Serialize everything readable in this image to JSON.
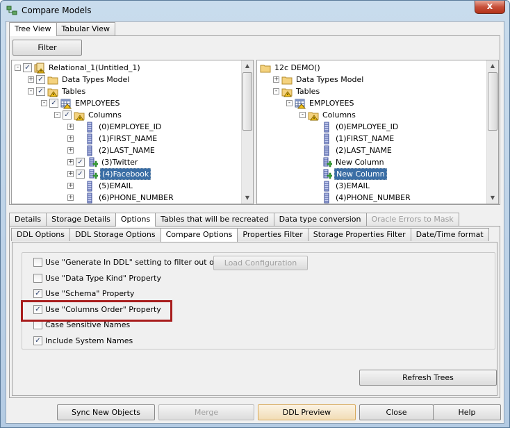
{
  "window": {
    "title": "Compare Models",
    "close_glyph": "x"
  },
  "top_tabs": [
    {
      "label": "Tree View",
      "active": true
    },
    {
      "label": "Tabular View",
      "active": false
    }
  ],
  "filter_button": "Filter",
  "left_tree": [
    {
      "label": "Relational_1(Untitled_1)",
      "depth": 0,
      "exp": "-",
      "check": true,
      "icon": "relational-model-icon"
    },
    {
      "label": "Data Types Model",
      "depth": 1,
      "exp": "+",
      "check": true,
      "icon": "folder-icon"
    },
    {
      "label": "Tables",
      "depth": 1,
      "exp": "-",
      "check": true,
      "icon": "folder-warning-icon"
    },
    {
      "label": "EMPLOYEES",
      "depth": 2,
      "exp": "-",
      "check": true,
      "icon": "table-icon"
    },
    {
      "label": "Columns",
      "depth": 3,
      "exp": "-",
      "check": true,
      "icon": "folder-warning-icon"
    },
    {
      "label": "(0)EMPLOYEE_ID",
      "depth": 4,
      "exp": "+",
      "check": null,
      "icon": "column-icon"
    },
    {
      "label": "(1)FIRST_NAME",
      "depth": 4,
      "exp": "+",
      "check": null,
      "icon": "column-icon"
    },
    {
      "label": "(2)LAST_NAME",
      "depth": 4,
      "exp": "+",
      "check": null,
      "icon": "column-icon"
    },
    {
      "label": "(3)Twitter",
      "depth": 4,
      "exp": "+",
      "check": true,
      "icon": "column-new-icon"
    },
    {
      "label": "(4)Facebook",
      "depth": 4,
      "exp": "+",
      "check": true,
      "icon": "column-new-icon",
      "selected": true
    },
    {
      "label": "(5)EMAIL",
      "depth": 4,
      "exp": "+",
      "check": null,
      "icon": "column-icon"
    },
    {
      "label": "(6)PHONE_NUMBER",
      "depth": 4,
      "exp": "+",
      "check": null,
      "icon": "column-icon"
    }
  ],
  "right_tree": [
    {
      "label": "12c DEMO()",
      "depth": 0,
      "exp": null,
      "check": null,
      "icon": "folder-icon"
    },
    {
      "label": "Data Types Model",
      "depth": 1,
      "exp": "+",
      "check": null,
      "icon": "folder-icon"
    },
    {
      "label": "Tables",
      "depth": 1,
      "exp": "-",
      "check": null,
      "icon": "folder-warning-icon"
    },
    {
      "label": "EMPLOYEES",
      "depth": 2,
      "exp": "-",
      "check": null,
      "icon": "table-icon"
    },
    {
      "label": "Columns",
      "depth": 3,
      "exp": "-",
      "check": null,
      "icon": "folder-warning-icon"
    },
    {
      "label": "(0)EMPLOYEE_ID",
      "depth": 4,
      "exp": null,
      "check": null,
      "icon": "column-icon"
    },
    {
      "label": "(1)FIRST_NAME",
      "depth": 4,
      "exp": null,
      "check": null,
      "icon": "column-icon"
    },
    {
      "label": "(2)LAST_NAME",
      "depth": 4,
      "exp": null,
      "check": null,
      "icon": "column-icon"
    },
    {
      "label": "New Column",
      "depth": 4,
      "exp": null,
      "check": null,
      "icon": "column-new-icon"
    },
    {
      "label": "New Column",
      "depth": 4,
      "exp": null,
      "check": null,
      "icon": "column-new-icon",
      "selected": true
    },
    {
      "label": "(3)EMAIL",
      "depth": 4,
      "exp": null,
      "check": null,
      "icon": "column-icon"
    },
    {
      "label": "(4)PHONE_NUMBER",
      "depth": 4,
      "exp": null,
      "check": null,
      "icon": "column-icon"
    }
  ],
  "detail_tabs": [
    {
      "label": "Details",
      "active": false,
      "disabled": false
    },
    {
      "label": "Storage Details",
      "active": false,
      "disabled": false
    },
    {
      "label": "Options",
      "active": true,
      "disabled": false
    },
    {
      "label": "Tables that will be recreated",
      "active": false,
      "disabled": false
    },
    {
      "label": "Data type conversion",
      "active": false,
      "disabled": false
    },
    {
      "label": "Oracle Errors to Mask",
      "active": false,
      "disabled": true
    }
  ],
  "option_tabs": [
    {
      "label": "DDL Options",
      "active": false
    },
    {
      "label": "DDL Storage Options",
      "active": false
    },
    {
      "label": "Compare Options",
      "active": true
    },
    {
      "label": "Properties Filter",
      "active": false
    },
    {
      "label": "Storage Properties Filter",
      "active": false
    },
    {
      "label": "Date/Time format",
      "active": false
    }
  ],
  "compare_options": [
    {
      "label": "Use \"Generate In DDL\" setting to filter out objects",
      "checked": false
    },
    {
      "label": "Use \"Data Type Kind\" Property",
      "checked": false
    },
    {
      "label": "Use \"Schema\" Property",
      "checked": true
    },
    {
      "label": "Use \"Columns Order\" Property",
      "checked": true
    },
    {
      "label": "Case Sensitive Names",
      "checked": false
    },
    {
      "label": "Include System Names",
      "checked": true
    }
  ],
  "load_configuration_button": "Load Configuration",
  "refresh_trees_button": "Refresh Trees",
  "footer_buttons": {
    "sync": "Sync New Objects",
    "merge": "Merge",
    "ddl_preview": "DDL Preview",
    "close": "Close",
    "help": "Help"
  },
  "colors": {
    "selection": "#3b6ea5",
    "highlight_box": "#a81d1d",
    "window_frame": "#b4cbe3"
  },
  "check_glyph": "✓"
}
